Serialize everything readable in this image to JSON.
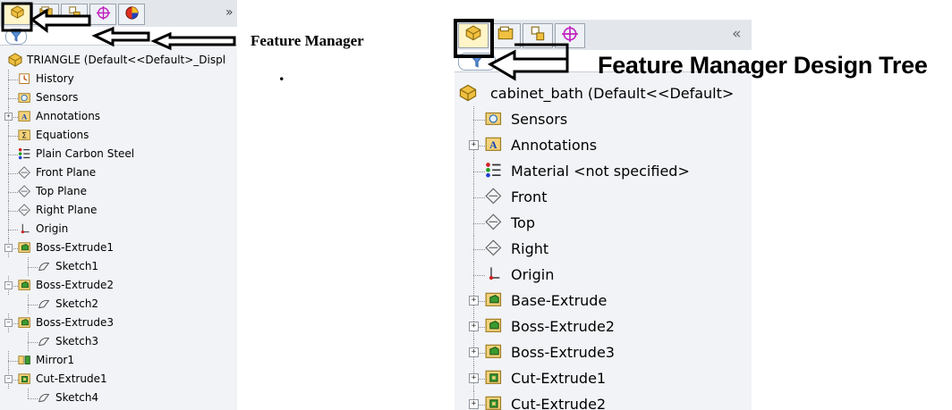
{
  "left_panel": {
    "tabs": [
      "featuremanager-tab-icon",
      "propertymanager-tab-icon",
      "configurationmanager-tab-icon",
      "dimxpert-tab-icon",
      "display-manager-tab-icon"
    ],
    "overflow_glyph": "»",
    "filter_icon": "filter-icon",
    "root": "TRIANGLE  (Default<<Default>_Displ",
    "items": [
      {
        "label": "History",
        "icon": "history-icon",
        "indent": 1,
        "expander": false
      },
      {
        "label": "Sensors",
        "icon": "sensors-icon",
        "indent": 1,
        "expander": false
      },
      {
        "label": "Annotations",
        "icon": "annotations-icon",
        "indent": 1,
        "expander": "plus"
      },
      {
        "label": "Equations",
        "icon": "equations-icon",
        "indent": 1,
        "expander": false
      },
      {
        "label": "Plain Carbon Steel",
        "icon": "material-icon",
        "indent": 1,
        "expander": false
      },
      {
        "label": "Front Plane",
        "icon": "plane-icon",
        "indent": 1,
        "expander": false
      },
      {
        "label": "Top Plane",
        "icon": "plane-icon",
        "indent": 1,
        "expander": false
      },
      {
        "label": "Right Plane",
        "icon": "plane-icon",
        "indent": 1,
        "expander": false
      },
      {
        "label": "Origin",
        "icon": "origin-icon",
        "indent": 1,
        "expander": false
      },
      {
        "label": "Boss-Extrude1",
        "icon": "extrude-icon",
        "indent": 1,
        "expander": "minus"
      },
      {
        "label": "Sketch1",
        "icon": "sketch-icon",
        "indent": 2,
        "expander": false
      },
      {
        "label": "Boss-Extrude2",
        "icon": "extrude-icon",
        "indent": 1,
        "expander": "minus"
      },
      {
        "label": "Sketch2",
        "icon": "sketch-icon",
        "indent": 2,
        "expander": false
      },
      {
        "label": "Boss-Extrude3",
        "icon": "extrude-icon",
        "indent": 1,
        "expander": "minus"
      },
      {
        "label": "Sketch3",
        "icon": "sketch-icon",
        "indent": 2,
        "expander": false
      },
      {
        "label": "Mirror1",
        "icon": "mirror-icon",
        "indent": 1,
        "expander": false
      },
      {
        "label": "Cut-Extrude1",
        "icon": "cut-extrude-icon",
        "indent": 1,
        "expander": "minus"
      },
      {
        "label": "Sketch4",
        "icon": "sketch-icon",
        "indent": 2,
        "expander": false
      }
    ]
  },
  "right_panel": {
    "tabs": [
      "featuremanager-tab-icon",
      "propertymanager-tab-icon",
      "configurationmanager-tab-icon",
      "dimxpert-tab-icon"
    ],
    "collapse_glyph": "«",
    "filter_icon": "filter-icon",
    "root": "cabinet_bath  (Default<<Default>",
    "items": [
      {
        "label": "Sensors",
        "icon": "sensors-icon",
        "expander": false
      },
      {
        "label": "Annotations",
        "icon": "annotations-icon",
        "expander": "plus"
      },
      {
        "label": "Material <not specified>",
        "icon": "material-icon",
        "expander": false
      },
      {
        "label": "Front",
        "icon": "plane-icon",
        "expander": false
      },
      {
        "label": "Top",
        "icon": "plane-icon",
        "expander": false
      },
      {
        "label": "Right",
        "icon": "plane-icon",
        "expander": false
      },
      {
        "label": "Origin",
        "icon": "origin-icon",
        "expander": false
      },
      {
        "label": "Base-Extrude",
        "icon": "extrude-icon",
        "expander": "plus"
      },
      {
        "label": "Boss-Extrude2",
        "icon": "extrude-icon",
        "expander": "plus"
      },
      {
        "label": "Boss-Extrude3",
        "icon": "extrude-icon",
        "expander": "plus"
      },
      {
        "label": "Cut-Extrude1",
        "icon": "cut-extrude-icon",
        "expander": "plus"
      },
      {
        "label": "Cut-Extrude2",
        "icon": "cut-extrude-icon",
        "expander": "plus"
      }
    ]
  },
  "captions": {
    "left": "Feature Manager",
    "dot": ".",
    "right": "Feature Manager Design Tree"
  },
  "colors": {
    "panel_bg": "#f1f3f6",
    "tab_active": "#fff5c8",
    "annotation_arrow": "#000000"
  }
}
